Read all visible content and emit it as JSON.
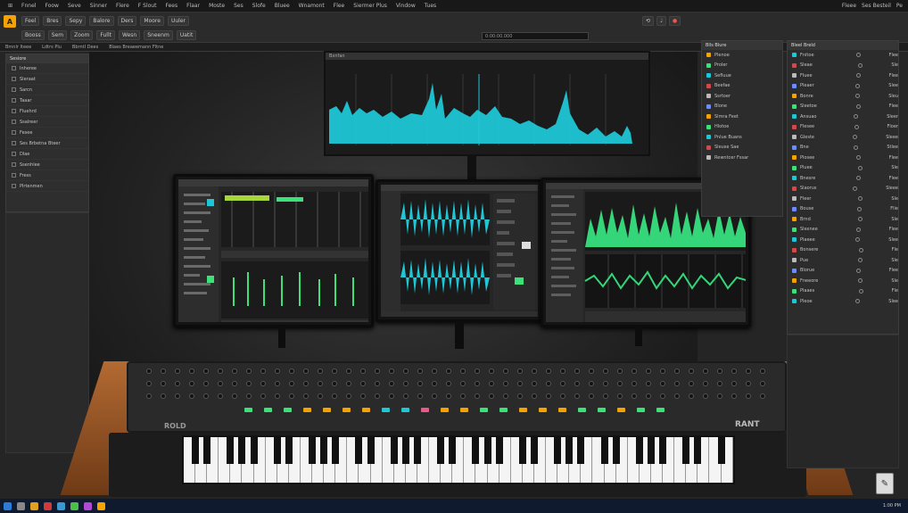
{
  "menubar": {
    "items": [
      "Fnnel",
      "Foow",
      "Seve",
      "Sinner",
      "Flere",
      "F Slout",
      "Fees",
      "Flaar",
      "Moste",
      "Ses",
      "Slofe",
      "Bluee",
      "Wnamont",
      "Flee",
      "Siermer Plus",
      "Vindow",
      "Tues"
    ],
    "right_items": [
      "Fleee",
      "Ses Besteil",
      "Pe"
    ]
  },
  "toolbar": {
    "logo": "A",
    "row1": [
      "Feel",
      "Bres",
      "Sepy",
      "Balore",
      "Ders",
      "Moore",
      "Uuler"
    ],
    "row2": [
      "Booss",
      "Sem",
      "Zoom",
      "Fullt",
      "Wesn",
      "Sneenm",
      "Uatit"
    ],
    "transport_time": "0:00:00.000"
  },
  "tabs": [
    "Bmnlr Iteee",
    "Ldtrs Plu",
    "Bbrntl Dees",
    "Blaes Breaeemann Fltne"
  ],
  "left_panel": {
    "header": "Sesiore",
    "items": [
      "Inheree",
      "Sleraat",
      "Sarcn",
      "Taaar",
      "Fluehrd",
      "Ssalreer",
      "Fesee",
      "Ses Brbetna Bteer",
      "Dlae",
      "Ssenhlee",
      "Fress",
      "Plrtenmen"
    ]
  },
  "top_monitor": {
    "title": "Bxnfan"
  },
  "right_panel_a": {
    "header": "Blls Blure",
    "items": [
      "Plenoe",
      "Proler",
      "Sefluue",
      "Beefae",
      "Ssrtoer",
      "Blone",
      "Slmra Feet",
      "Hlotoe",
      "Pnlue Buans",
      "Sleuse Sae",
      "Rewntcer Fssar"
    ]
  },
  "right_panel_b": {
    "header": "Bleel Breld",
    "items": [
      "Fnitoe",
      "Sleae",
      "Fluee",
      "Pleaer",
      "Bonre",
      "Sleetoe",
      "Ansuao",
      "Flesee",
      "Gleste",
      "Bne",
      "Plosee",
      "Pluee",
      "Bnesre",
      "Slaorus",
      "Fleer",
      "Bouse",
      "Brnd",
      "Slexnee",
      "Plaeee",
      "Bonsere",
      "Pue",
      "Blorue",
      "Fneeore",
      "Plaaes",
      "Pleoe"
    ],
    "right_items": [
      "Flee",
      "Sle",
      "Flee",
      "Slee",
      "Sleu",
      "Flee",
      "Sleer",
      "Floer",
      "Sleee",
      "Stlee",
      "Flee",
      "Sle",
      "Flee",
      "Sleee",
      "Sle",
      "Flie",
      "Sle",
      "Flee",
      "Slee",
      "Fle",
      "Sle",
      "Flee",
      "Sle",
      "Fle",
      "Slee"
    ]
  },
  "synth": {
    "brand": "ROLD",
    "brand_right": "RANT"
  },
  "taskbar": {
    "clock": "1:00 PM"
  }
}
